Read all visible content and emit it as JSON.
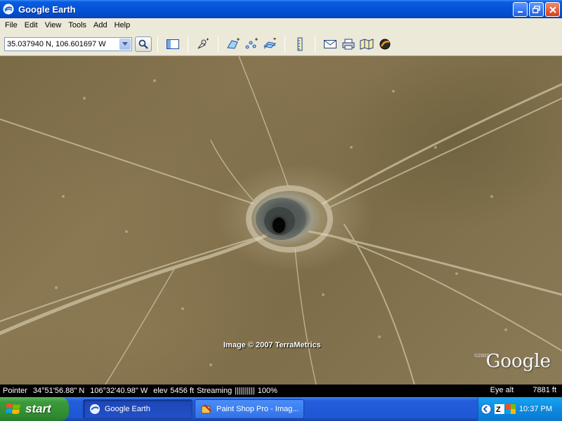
{
  "window": {
    "title": "Google Earth",
    "controls": [
      "minimize",
      "restore",
      "close"
    ]
  },
  "menu": [
    "File",
    "Edit",
    "View",
    "Tools",
    "Add",
    "Help"
  ],
  "toolbar": {
    "search_value": "35.037940 N, 106.601697 W",
    "buttons": [
      "sidebar-toggle-icon",
      "placemark-icon",
      "polygon-icon",
      "path-icon",
      "image-overlay-icon",
      "ruler-icon",
      "email-icon",
      "print-icon",
      "maps-icon",
      "sky-icon"
    ]
  },
  "map": {
    "attribution": "Image © 2007 TerraMetrics",
    "logo": "Google",
    "logo_small": "©2007"
  },
  "status": {
    "pointer_label": "Pointer",
    "lat": "34°51'56.88\" N",
    "lon": "106°32'40.98\" W",
    "elev_label": "elev",
    "elev": "5456 ft",
    "streaming_label": "Streaming",
    "streaming_bar": "||||||||||",
    "streaming_pct": "100%",
    "eye_alt_label": "Eye alt",
    "eye_alt": "7881 ft"
  },
  "taskbar": {
    "start_label": "start",
    "tasks": [
      {
        "label": "Google Earth",
        "active": true
      },
      {
        "label": "Paint Shop Pro - Imag...",
        "active": false
      }
    ],
    "clock": "10:37 PM"
  }
}
